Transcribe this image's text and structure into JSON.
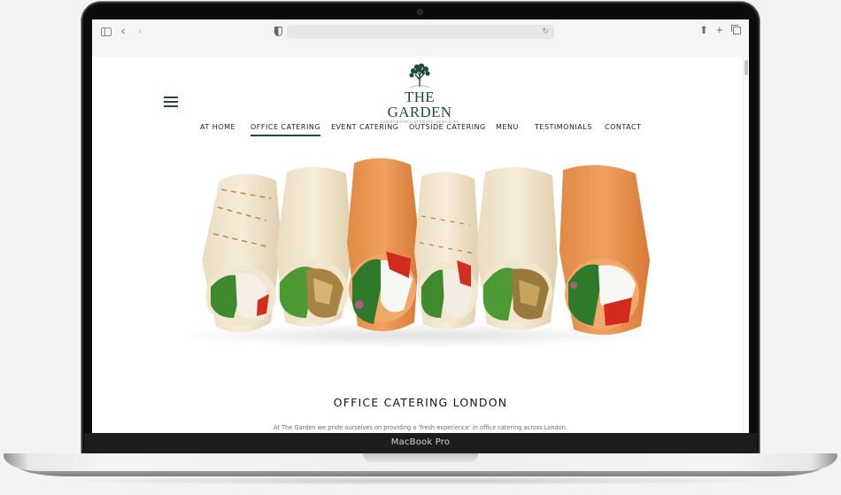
{
  "device": {
    "model_label": "MacBook Pro"
  },
  "browser": {
    "toolbar_icons": [
      "sidebar-icon",
      "back-icon",
      "forward-icon",
      "shield-icon",
      "reload-icon",
      "share-icon",
      "new-tab-icon",
      "tabs-overview-icon"
    ],
    "url": ""
  },
  "site": {
    "logo": {
      "title": "THE GARDEN",
      "subtitle": "CORPORATE CATERING SERVICES"
    },
    "nav": {
      "items": [
        {
          "label": "AT HOME",
          "active": false
        },
        {
          "label": "OFFICE CATERING",
          "active": true
        },
        {
          "label": "EVENT CATERING",
          "active": false
        },
        {
          "label": "OUTSIDE CATERING",
          "active": false
        },
        {
          "label": "MENU",
          "active": false
        },
        {
          "label": "TESTIMONIALS",
          "active": false
        },
        {
          "label": "CONTACT",
          "active": false
        }
      ]
    },
    "hero_image": {
      "alt": "Six assorted tortilla wraps with chicken, salad, feta and roasted peppers"
    },
    "section": {
      "title": "OFFICE CATERING LONDON",
      "intro": "At The Garden we pride ourselves on providing a ‘fresh experience’ in office catering across London."
    },
    "colors": {
      "brand_green": "#1f4d3a",
      "text_dark": "#151515",
      "text_muted": "#6b6b6b"
    }
  }
}
